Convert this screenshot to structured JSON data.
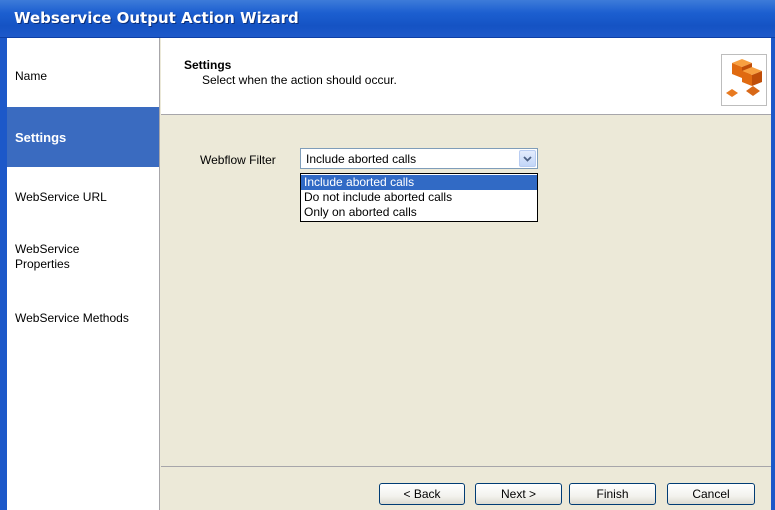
{
  "window": {
    "title": "Webservice Output Action Wizard"
  },
  "sidebar": {
    "items": [
      {
        "label": "Name"
      },
      {
        "label": "Settings"
      },
      {
        "label": "WebService URL"
      },
      {
        "label": "WebService\nProperties"
      },
      {
        "label": "WebService Methods"
      }
    ],
    "active": "Settings"
  },
  "header": {
    "title": "Settings",
    "subtitle": "Select when the action should occur.",
    "icon": "cubes-icon"
  },
  "filter": {
    "label": "Webflow Filter",
    "value": "Include aborted calls",
    "options": [
      "Include aborted calls",
      "Do not include aborted calls",
      "Only on aborted calls"
    ]
  },
  "buttons": {
    "back": "< Back",
    "next": "Next >",
    "finish": "Finish",
    "cancel": "Cancel"
  },
  "colors": {
    "titlebar": "#1c5fd0",
    "sidebar_active": "#3a6bc0",
    "selection": "#316ac5",
    "panel": "#ece9d8"
  }
}
